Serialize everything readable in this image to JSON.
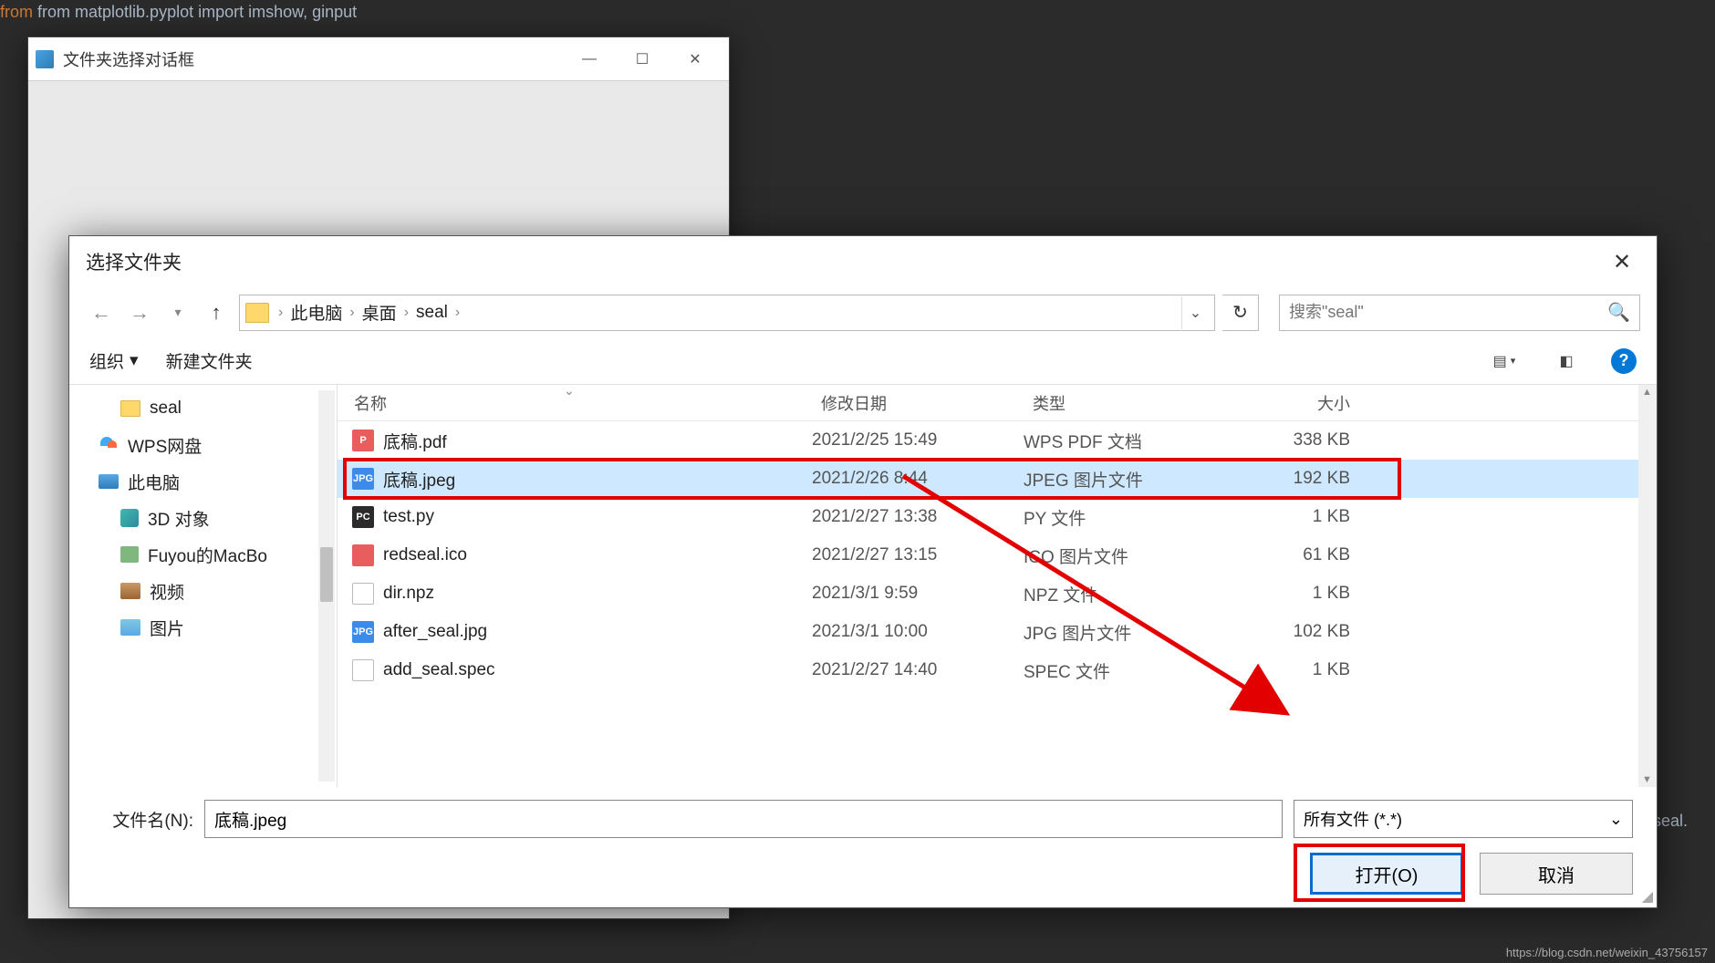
{
  "editor": {
    "line1": "from matplotlib.pyplot import imshow, ginput",
    "seal_hint": "seal."
  },
  "parent_dialog": {
    "title": "文件夹选择对话框"
  },
  "chooser": {
    "title": "选择文件夹",
    "breadcrumbs": [
      "此电脑",
      "桌面",
      "seal"
    ],
    "search_placeholder": "搜索\"seal\"",
    "toolbar": {
      "organize": "组织",
      "new_folder": "新建文件夹"
    },
    "tree": {
      "seal": "seal",
      "wps": "WPS网盘",
      "this_pc": "此电脑",
      "obj3d": "3D 对象",
      "macbook": "Fuyou的MacBo",
      "video": "视频",
      "pictures": "图片"
    },
    "columns": {
      "name": "名称",
      "date": "修改日期",
      "type": "类型",
      "size": "大小"
    },
    "files": [
      {
        "icon": "pdf",
        "name": "底稿.pdf",
        "date": "2021/2/25 15:49",
        "type": "WPS PDF 文档",
        "size": "338 KB",
        "selected": false
      },
      {
        "icon": "jpg",
        "name": "底稿.jpeg",
        "date": "2021/2/26 8:44",
        "type": "JPEG 图片文件",
        "size": "192 KB",
        "selected": true
      },
      {
        "icon": "py",
        "name": "test.py",
        "date": "2021/2/27 13:38",
        "type": "PY 文件",
        "size": "1 KB",
        "selected": false
      },
      {
        "icon": "ico",
        "name": "redseal.ico",
        "date": "2021/2/27 13:15",
        "type": "ICO 图片文件",
        "size": "61 KB",
        "selected": false
      },
      {
        "icon": "generic",
        "name": "dir.npz",
        "date": "2021/3/1 9:59",
        "type": "NPZ 文件",
        "size": "1 KB",
        "selected": false
      },
      {
        "icon": "jpg",
        "name": "after_seal.jpg",
        "date": "2021/3/1 10:00",
        "type": "JPG 图片文件",
        "size": "102 KB",
        "selected": false
      },
      {
        "icon": "generic",
        "name": "add_seal.spec",
        "date": "2021/2/27 14:40",
        "type": "SPEC 文件",
        "size": "1 KB",
        "selected": false
      }
    ],
    "filename_label": "文件名(N):",
    "filename_value": "底稿.jpeg",
    "filter_label": "所有文件 (*.*)",
    "open_label": "打开(O)",
    "cancel_label": "取消"
  },
  "watermark": "https://blog.csdn.net/weixin_43756157"
}
